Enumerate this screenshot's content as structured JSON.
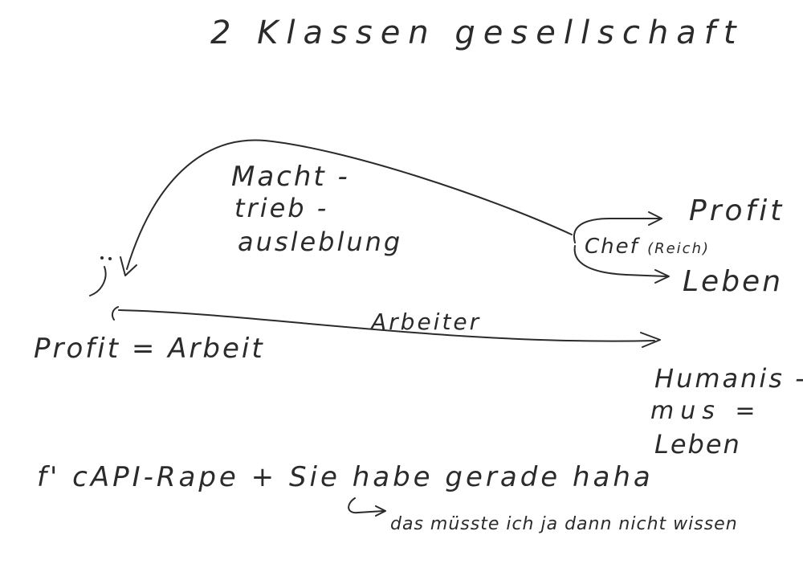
{
  "title": "2 Klassen gesellschaft",
  "left_node": {
    "label": "Profit = Arbeit"
  },
  "upper_arrow": {
    "label_lines": [
      "Macht -",
      "trieb -",
      "ausleblung"
    ]
  },
  "right_node": {
    "label": "Chef",
    "sublabel": "(Reich)",
    "outputs": [
      "Profit",
      "Leben"
    ]
  },
  "lower_arrow": {
    "label": "Arbeiter"
  },
  "right_bottom": {
    "lines": [
      "Humanis -",
      "mus =",
      "Leben"
    ]
  },
  "bottom_note": {
    "line1": "f' cAPI-Rape + Sie habe gerade haha",
    "line2": "das müsste ich ja dann nicht wissen"
  }
}
